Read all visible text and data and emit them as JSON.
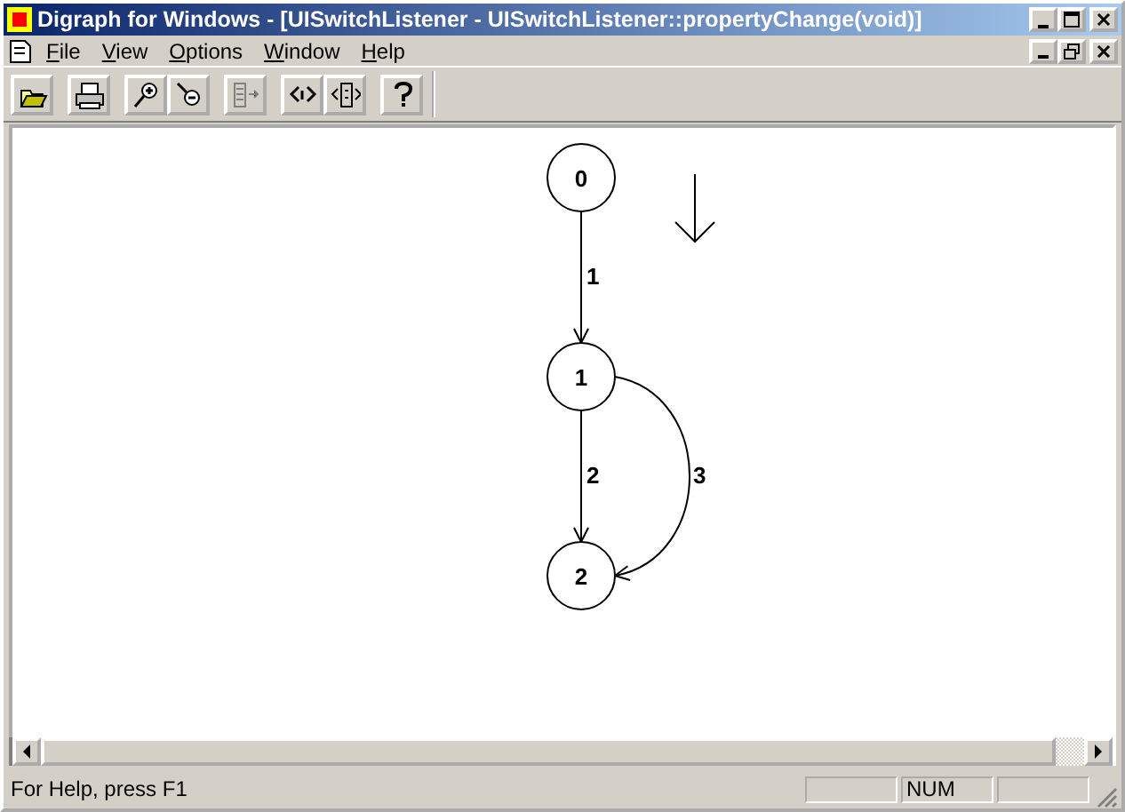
{
  "window": {
    "title": "Digraph for Windows - [UISwitchListener - UISwitchListener::propertyChange(void)]"
  },
  "menu": [
    {
      "label": "File"
    },
    {
      "label": "View"
    },
    {
      "label": "Options"
    },
    {
      "label": "Window"
    },
    {
      "label": "Help"
    }
  ],
  "toolbar": [
    {
      "disabled": false
    },
    {
      "disabled": false
    },
    {
      "disabled": false
    },
    {
      "disabled": false
    },
    {
      "disabled": true
    },
    {
      "disabled": false
    },
    {
      "disabled": false
    },
    {
      "disabled": false
    }
  ],
  "graph": {
    "nodes": [
      {
        "label": "0"
      },
      {
        "label": "1"
      },
      {
        "label": "2"
      }
    ],
    "edges": [
      {
        "label": "1",
        "kind": "straight"
      },
      {
        "label": "2",
        "kind": "straight"
      },
      {
        "label": "3",
        "kind": "curved"
      }
    ]
  },
  "status_bar": {
    "text": "For Help, press F1",
    "indicator": "NUM"
  }
}
